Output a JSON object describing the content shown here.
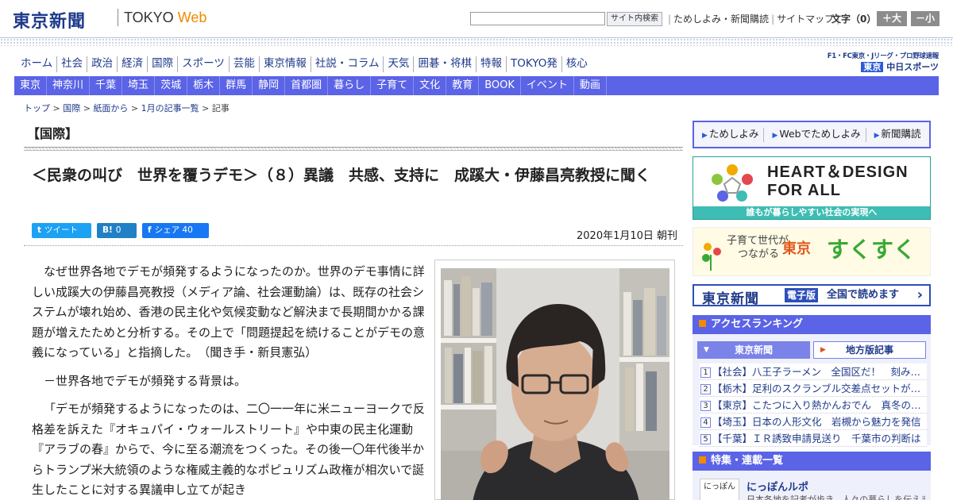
{
  "header": {
    "logo_jp": "東京新聞",
    "logo_en_prefix": "TOKYO ",
    "logo_en_web": "Web",
    "search_button": "サイト内検索",
    "links": [
      "ためしよみ・新聞購読",
      "サイトマップ"
    ],
    "font_size_label": "文字（0）",
    "font_larger": "＋大",
    "font_smaller": "－小"
  },
  "nav": {
    "main": [
      "ホーム",
      "社会",
      "政治",
      "経済",
      "国際",
      "スポーツ",
      "芸能",
      "東京情報",
      "社説・コラム",
      "天気",
      "囲碁・将棋",
      "特報",
      "TOKYO発",
      "核心"
    ],
    "sub": [
      "東京",
      "神奈川",
      "千葉",
      "埼玉",
      "茨城",
      "栃木",
      "群馬",
      "静岡",
      "首都圏",
      "暮らし",
      "子育て",
      "文化",
      "教育",
      "BOOK",
      "イベント",
      "動画"
    ],
    "sports_promo_line1": "F1・FC東京・Jリーグ・プロ野球速報",
    "sports_promo_prefix": "東京",
    "sports_promo_brand": "中日スポーツ"
  },
  "breadcrumb": {
    "items": [
      "トップ",
      "国際",
      "紙面から",
      "1月の記事一覧"
    ],
    "current": "記事",
    "separator": " > "
  },
  "article": {
    "section": "【国際】",
    "headline": "＜民衆の叫び　世界を覆うデモ＞（８）異議　共感、支持に　成蹊大・伊藤昌亮教授に聞く",
    "share": {
      "tweet_icon": "t",
      "tweet": "ツイート",
      "hatena_icon": "B!",
      "hatena_count": "0",
      "fb_icon": "f",
      "fb_label": "シェア",
      "fb_count": "40"
    },
    "date": "2020年1月10日 朝刊",
    "paragraphs": [
      "なぜ世界各地でデモが頻発するようになったのか。世界のデモ事情に詳しい成蹊大の伊藤昌亮教授（メディア論、社会運動論）は、既存の社会システムが壊れ始め、香港の民主化や気候変動など解決まで長期間かかる課題が増えたためと分析する。その上で「問題提起を続けることがデモの意義になっている」と指摘した。　（聞き手・新貝憲弘）",
      "－世界各地でデモが頻発する背景は。",
      "「デモが頻発するようになったのは、二〇一一年に米ニューヨークで反格差を訴えた『オキュパイ・ウォールストリート』や中東の民主化運動『アラブの春』からで、今に至る潮流をつくった。その後一〇年代後半からトランプ米大統領のような権威主義的なポピュリズム政権が相次いで誕生したことに対する異議申し立てが起き"
    ]
  },
  "sidebar": {
    "top_links": [
      "ためしよみ",
      "Webでためしよみ",
      "新聞購読"
    ],
    "heart_design_line1": "HEART＆DESIGN",
    "heart_design_line2": "FOR ALL",
    "heart_design_sub": "誰もが暮らしやすい社会の実現へ",
    "sukusuku_line1": "子育て世代が",
    "sukusuku_line2": "つながる",
    "sukusuku_tokyo": "東京",
    "sukusuku_brand": "すくすく",
    "epaper_logo": "東京新聞",
    "epaper_badge": "電子版",
    "epaper_text": "全国で読めます",
    "ranking_title": "アクセスランキング",
    "ranking_tabs": [
      "東京新聞",
      "地方版記事"
    ],
    "ranking": [
      {
        "num": "1",
        "text": "【社会】八王子ラーメン　全国区だ！　刻みタマネギ"
      },
      {
        "num": "2",
        "text": "【栃木】足利のスクランブル交差点セットが人気"
      },
      {
        "num": "3",
        "text": "【東京】こたつに入り熱かんおでん　真冬の屋形船"
      },
      {
        "num": "4",
        "text": "【埼玉】日本の人形文化　岩槻から魅力を発信"
      },
      {
        "num": "5",
        "text": "【千葉】ＩＲ誘致申請見送り　千葉市の判断は"
      }
    ],
    "feature_title": "特集・連載一覧",
    "feature_thumb": "にっぽん",
    "feature_item": "にっぽんルポ",
    "feature_desc": "日本各地を記者が歩き、人々の暮らしを伝えます"
  },
  "colors": {
    "nav_bar": "#5b63e6",
    "brand_blue": "#1f3a8a",
    "accent_orange": "#f08a00"
  }
}
